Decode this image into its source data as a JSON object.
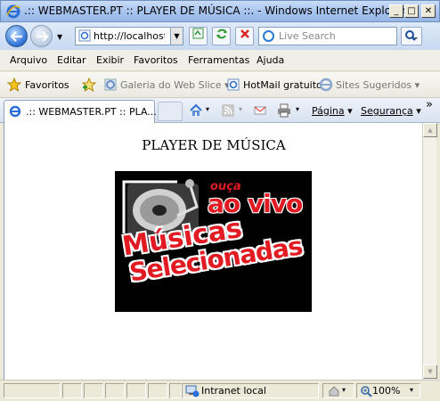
{
  "window": {
    "title": ".:: WEBMASTER.PT :: PLAYER DE MÚSICA ::. - Windows Internet Explorer",
    "minimize": "_",
    "maximize": "□",
    "close": "✕"
  },
  "address_bar": {
    "url": "http://localhost/a",
    "search_placeholder": "Live Search"
  },
  "menu": [
    "Arquivo",
    "Editar",
    "Exibir",
    "Favoritos",
    "Ferramentas",
    "Ajuda"
  ],
  "favorites_bar": {
    "favorites_label": "Favoritos",
    "items": [
      {
        "label": "Galeria do Web Slice",
        "dropdown": "▾"
      },
      {
        "label": "HotMail gratuito"
      },
      {
        "label": "Sites Sugeridos",
        "dropdown": "▾"
      }
    ]
  },
  "tabs": {
    "active_label": ".:: WEBMASTER.PT :: PLA...",
    "chevron": "»"
  },
  "command_bar": {
    "page_label": "Página",
    "security_label": "Segurança"
  },
  "page": {
    "heading": "PLAYER DE MÚSICA",
    "banner": {
      "top_small": "ouça",
      "top_big": "ao vivo",
      "line1": "Músicas",
      "line2": "Selecionadas"
    }
  },
  "status_bar": {
    "zone": "Intranet local",
    "zoom": "100%"
  },
  "colors": {
    "banner_red": "#d8141c",
    "banner_bg": "#000000",
    "ie_blue": "#2b6ed6"
  }
}
